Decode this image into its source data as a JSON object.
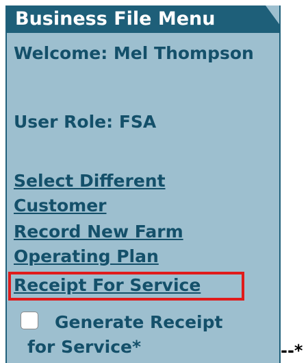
{
  "menu": {
    "title": "Business File Menu",
    "welcome_text": "Welcome: Mel Thompson",
    "user_role_text": "User Role: FSA",
    "links": [
      "Select Different Customer",
      "Record New Farm Operating Plan",
      "Receipt For Service"
    ],
    "checkbox": {
      "label_line_1": "Generate Receipt",
      "label_line_2": "for Service*",
      "checked": false
    }
  },
  "outside_note": "--*",
  "colors": {
    "header_background": "#1e5f79",
    "panel_background": "#9dbfcf",
    "text": "#14506a",
    "highlight_border": "#e01b1b"
  }
}
